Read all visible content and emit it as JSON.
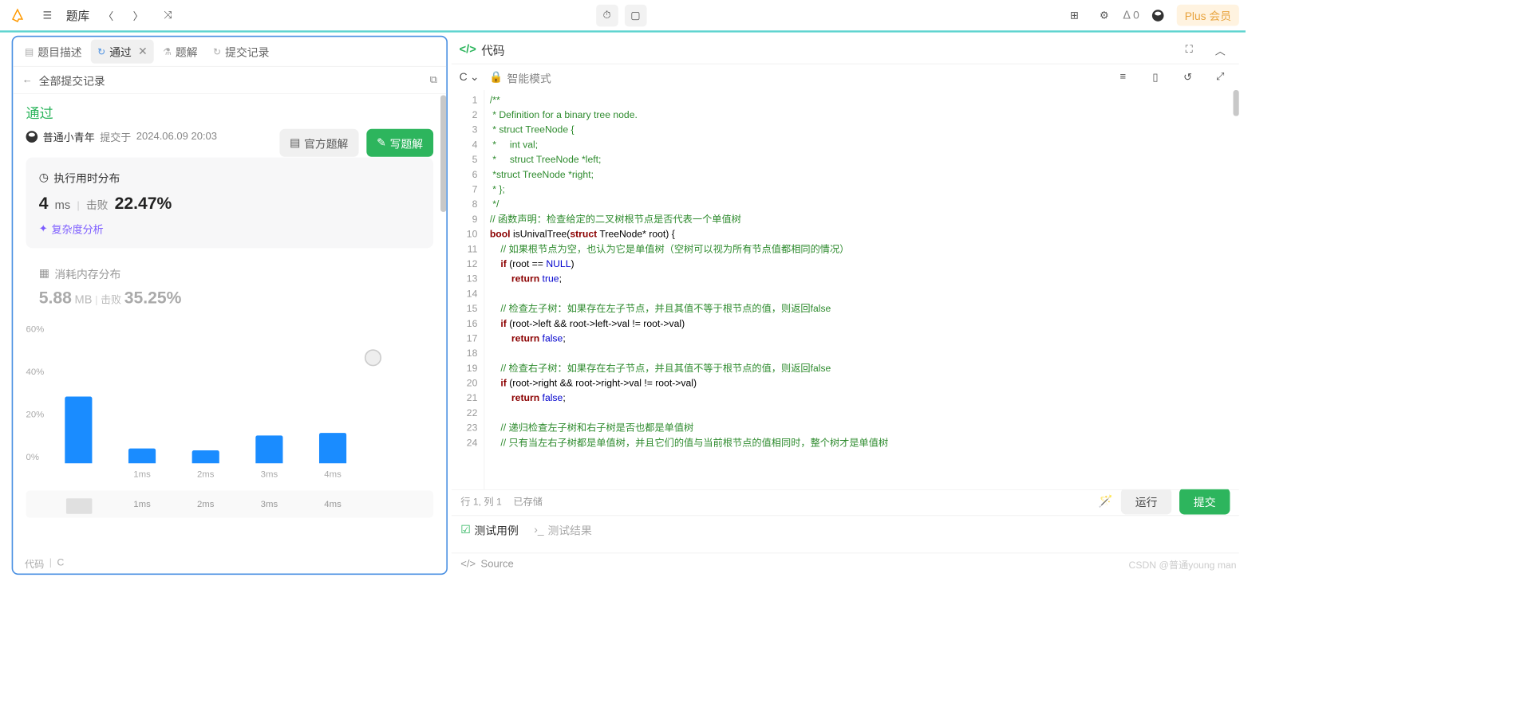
{
  "topbar": {
    "library": "题库",
    "streak_count": "0",
    "plus_label": "Plus 会员"
  },
  "left": {
    "tabs": {
      "desc": "题目描述",
      "pass": "通过",
      "solution": "题解",
      "submissions": "提交记录"
    },
    "subheader": {
      "title": "全部提交记录"
    },
    "status": "通过",
    "user": "普通小青年",
    "submitted_prefix": "提交于",
    "submitted_at": "2024.06.09 20:03",
    "buttons": {
      "official": "官方题解",
      "write": "写题解"
    },
    "runtime": {
      "title": "执行用时分布",
      "value": "4",
      "unit": "ms",
      "beats_label": "击败",
      "beats_pct": "22.47%"
    },
    "complexity": "复杂度分析",
    "memory": {
      "title": "消耗内存分布",
      "value": "5.88",
      "unit": "MB",
      "beats_label": "击败",
      "beats_pct": "35.25%"
    },
    "chart_data": {
      "type": "bar",
      "categories": [
        "",
        "1ms",
        "2ms",
        "3ms",
        "4ms"
      ],
      "values": [
        31,
        7,
        6,
        13,
        14
      ],
      "ylabel": "%",
      "ylim": [
        0,
        60
      ],
      "yticks": [
        "60%",
        "40%",
        "20%",
        "0%"
      ]
    },
    "minimap_labels": [
      "1ms",
      "2ms",
      "3ms",
      "4ms"
    ],
    "footer": {
      "code": "代码",
      "lang": "C"
    }
  },
  "editor": {
    "header": "代码",
    "language": "C",
    "mode": "智能模式",
    "lines": [
      {
        "n": 1,
        "html": "<span class='c-comment'>/**</span>"
      },
      {
        "n": 2,
        "html": "<span class='c-comment'> * Definition for a binary tree node.</span>"
      },
      {
        "n": 3,
        "html": "<span class='c-comment'> * struct TreeNode {</span>"
      },
      {
        "n": 4,
        "html": "<span class='c-comment'> *     int val;</span>"
      },
      {
        "n": 5,
        "html": "<span class='c-comment'> *     struct TreeNode *left;</span>"
      },
      {
        "n": 6,
        "html": "<span class='c-comment'> *struct TreeNode *right;</span>"
      },
      {
        "n": 7,
        "html": "<span class='c-comment'> * };</span>"
      },
      {
        "n": 8,
        "html": "<span class='c-comment'> */</span>"
      },
      {
        "n": 9,
        "html": "<span class='c-comment'>// 函数声明：检查给定的二叉树根节点是否代表一个单值树</span>"
      },
      {
        "n": 10,
        "html": "<span class='c-kw'>bool</span> isUnivalTree(<span class='c-kw'>struct</span> TreeNode* root) {"
      },
      {
        "n": 11,
        "html": "    <span class='c-comment'>// 如果根节点为空，也认为它是单值树（空树可以视为所有节点值都相同的情况）</span>"
      },
      {
        "n": 12,
        "html": "    <span class='c-kw'>if</span> (root == <span class='c-const'>NULL</span>)"
      },
      {
        "n": 13,
        "html": "        <span class='c-kw'>return</span> <span class='c-const'>true</span>;"
      },
      {
        "n": 14,
        "html": " "
      },
      {
        "n": 15,
        "html": "    <span class='c-comment'>// 检查左子树：如果存在左子节点，并且其值不等于根节点的值，则返回false</span>"
      },
      {
        "n": 16,
        "html": "    <span class='c-kw'>if</span> (root-&gt;left &amp;&amp; root-&gt;left-&gt;val != root-&gt;val)"
      },
      {
        "n": 17,
        "html": "        <span class='c-kw'>return</span> <span class='c-const'>false</span>;"
      },
      {
        "n": 18,
        "html": " "
      },
      {
        "n": 19,
        "html": "    <span class='c-comment'>// 检查右子树：如果存在右子节点，并且其值不等于根节点的值，则返回false</span>"
      },
      {
        "n": 20,
        "html": "    <span class='c-kw'>if</span> (root-&gt;right &amp;&amp; root-&gt;right-&gt;val != root-&gt;val)"
      },
      {
        "n": 21,
        "html": "        <span class='c-kw'>return</span> <span class='c-const'>false</span>;"
      },
      {
        "n": 22,
        "html": " "
      },
      {
        "n": 23,
        "html": "    <span class='c-comment'>// 递归检查左子树和右子树是否也都是单值树</span>"
      },
      {
        "n": 24,
        "html": "    <span class='c-comment'>// 只有当左右子树都是单值树，并且它们的值与当前根节点的值相同时，整个树才是单值树</span>"
      }
    ],
    "status_line": {
      "pos": "行 1, 列 1",
      "saved": "已存储"
    },
    "run": "运行",
    "submit": "提交",
    "testcases": "测试用例",
    "testresults": "测试结果",
    "source": "Source"
  },
  "watermark": "CSDN @普通young man"
}
